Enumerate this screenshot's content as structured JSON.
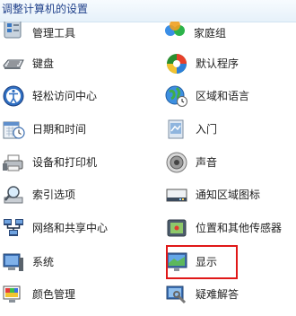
{
  "header": {
    "title": "调整计算机的设置"
  },
  "left_column": [
    {
      "label": "管理工具",
      "icon": "admin-tools-icon"
    },
    {
      "label": "键盘",
      "icon": "keyboard-icon"
    },
    {
      "label": "轻松访问中心",
      "icon": "ease-of-access-icon"
    },
    {
      "label": "日期和时间",
      "icon": "calendar-clock-icon"
    },
    {
      "label": "设备和打印机",
      "icon": "printer-icon"
    },
    {
      "label": "索引选项",
      "icon": "magnifier-index-icon"
    },
    {
      "label": "网络和共享中心",
      "icon": "network-icon"
    },
    {
      "label": "系统",
      "icon": "computer-system-icon"
    },
    {
      "label": "颜色管理",
      "icon": "color-management-icon"
    }
  ],
  "right_column": [
    {
      "label": "家庭组",
      "icon": "homegroup-icon"
    },
    {
      "label": "默认程序",
      "icon": "default-programs-icon"
    },
    {
      "label": "区域和语言",
      "icon": "globe-clock-icon"
    },
    {
      "label": "入门",
      "icon": "getting-started-icon"
    },
    {
      "label": "声音",
      "icon": "speaker-icon"
    },
    {
      "label": "通知区域图标",
      "icon": "notification-area-icon"
    },
    {
      "label": "位置和其他传感器",
      "icon": "location-sensor-icon"
    },
    {
      "label": "显示",
      "icon": "display-monitor-icon"
    },
    {
      "label": "疑难解答",
      "icon": "troubleshooting-icon"
    }
  ],
  "colors": {
    "highlight_border": "#e01818",
    "header_text": "#1e3f8a"
  }
}
